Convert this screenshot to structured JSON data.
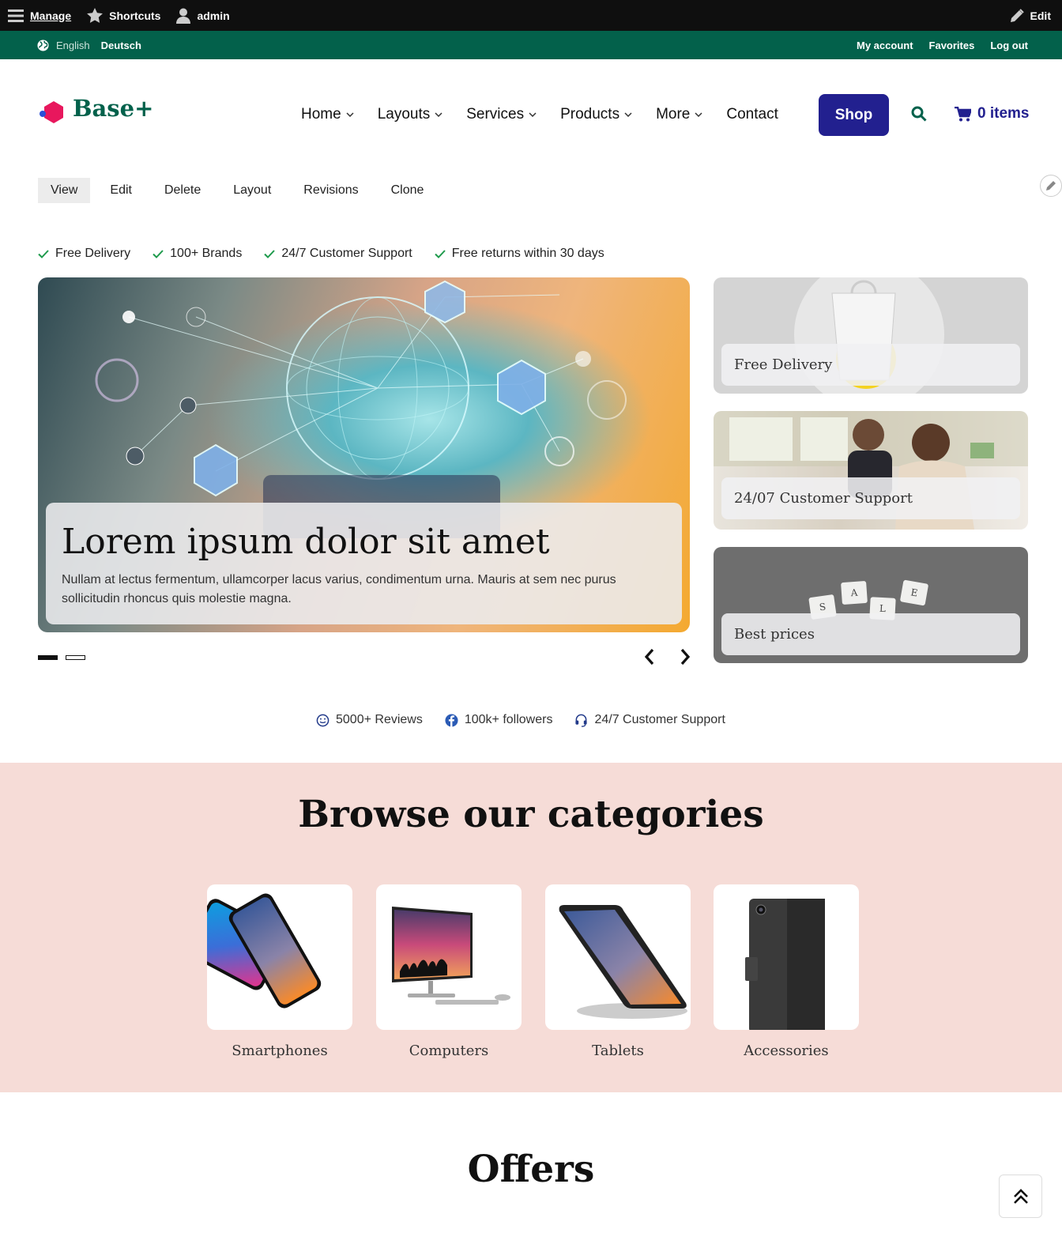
{
  "admin_toolbar": {
    "manage": "Manage",
    "shortcuts": "Shortcuts",
    "user": "admin",
    "edit": "Edit",
    "icons": [
      "menu-icon",
      "star-icon",
      "user-icon",
      "pencil-icon"
    ]
  },
  "secondary_bar": {
    "languages": [
      "English",
      "Deutsch"
    ],
    "links": [
      "My account",
      "Favorites",
      "Log out"
    ]
  },
  "header": {
    "logo_text": "Base+",
    "nav": [
      "Home",
      "Layouts",
      "Services",
      "Products",
      "More",
      "Contact"
    ],
    "shop": "Shop",
    "cart": "0 items",
    "colors": {
      "brand_green": "#03614b",
      "accent_blue": "#22208f",
      "logo_pink": "#e8175d"
    }
  },
  "tabs": [
    "View",
    "Edit",
    "Delete",
    "Layout",
    "Revisions",
    "Clone"
  ],
  "features": [
    "Free Delivery",
    "100+ Brands",
    "24/7 Customer Support",
    "Free returns within 30 days"
  ],
  "hero": {
    "title": "Lorem ipsum dolor sit amet",
    "text": "Nullam at lectus fermentum, ullamcorper lacus varius, condimentum urna. Mauris at sem nec purus sollicitudin rhoncus quis molestie magna.",
    "slides": 2,
    "active_slide": 1
  },
  "side_cards": [
    "Free Delivery",
    "24/07 Customer Support",
    "Best prices"
  ],
  "sale_tiles": [
    "S",
    "A",
    "L",
    "E"
  ],
  "social": [
    "5000+ Reviews",
    "100k+ followers",
    "24/7 Customer Support"
  ],
  "categories": {
    "title": "Browse our categories",
    "items": [
      "Smartphones",
      "Computers",
      "Tablets",
      "Accessories"
    ],
    "background": "#f6dcd7"
  },
  "offers_title": "Offers"
}
